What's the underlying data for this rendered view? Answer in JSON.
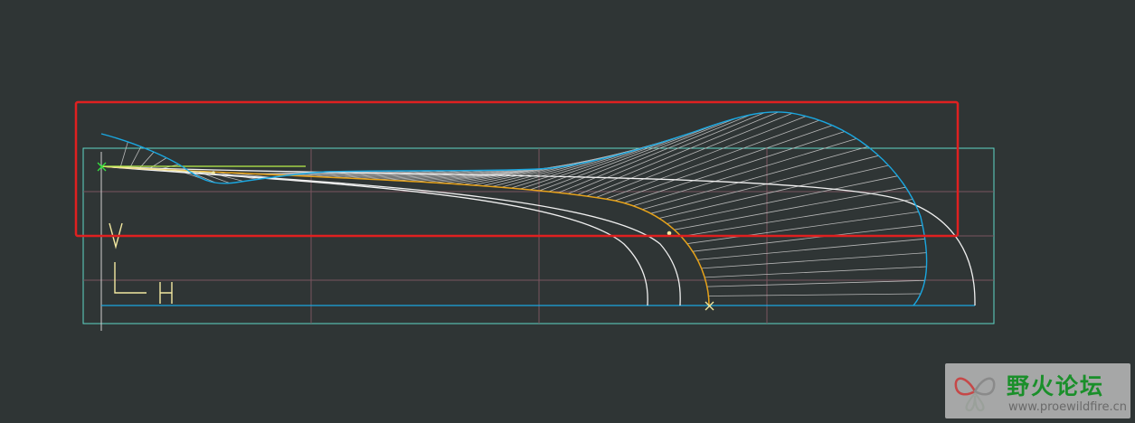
{
  "viewport": {
    "background": "#2f3535"
  },
  "colors": {
    "frame": "#5fd6c8",
    "grid": "#7a5560",
    "cyan_curve": "#1aa7e0",
    "white_curve": "#f0f0f0",
    "orange_curve": "#e6a21a",
    "hatch": "#b8b8b8",
    "yellow_curve": "#f2e8a0",
    "green_line": "#b9f04a",
    "green_marker": "#35e040",
    "axis_labels": "#f2e8a0",
    "highlight_box": "#e02020",
    "watermark_title": "#1a8f2a",
    "watermark_url": "#6a6a6a"
  },
  "axis_labels": {
    "vertical": "V",
    "horizontal": "H"
  },
  "icons": {
    "start_marker": "x-marker-icon",
    "end_marker": "x-marker-icon",
    "watermark_logo": "butterfly-logo-icon"
  },
  "watermark": {
    "title": "野火论坛",
    "url": "www.proewildfire.cn"
  }
}
